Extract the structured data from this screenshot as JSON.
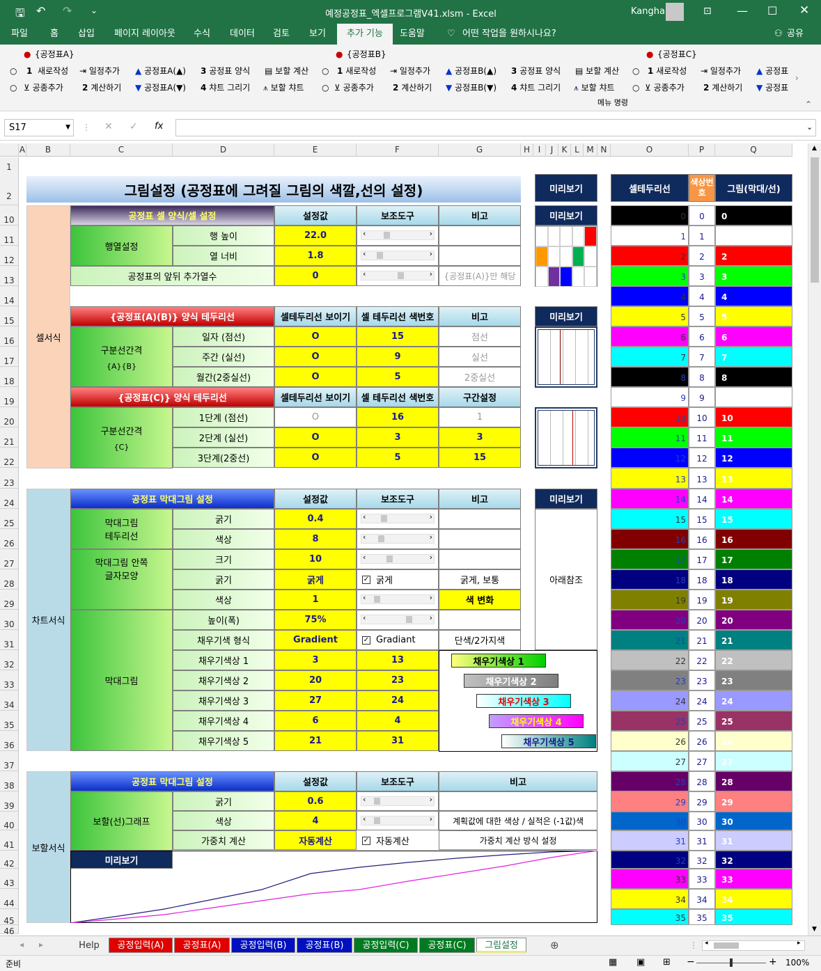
{
  "app": {
    "filename": "예정공정표_엑셀프로그램V41.xlsm",
    "app_name": "Excel",
    "user": "Kangha",
    "sep": "-"
  },
  "ribbon_tabs": [
    "파일",
    "홈",
    "삽입",
    "페이지 레이아웃",
    "수식",
    "데이터",
    "검토",
    "보기",
    "추가 기능",
    "도움말"
  ],
  "tell_me": "어떤 작업을 원하시나요?",
  "share": "공유",
  "ribbon": {
    "groups": [
      {
        "title": "{공정표A}",
        "r1": [
          "새로작성",
          "일정추가",
          "공정표A(▲)",
          "공정표 양식",
          "보할 계산"
        ],
        "r2": [
          "공종추가",
          "계산하기",
          "공정표A(▼)",
          "챠트 그리기",
          "보할 챠트"
        ]
      },
      {
        "title": "{공정표B}",
        "r1": [
          "새로작성",
          "일정추가",
          "공정표B(▲)",
          "공정표 양식",
          "보할 계산"
        ],
        "r2": [
          "공종추가",
          "계산하기",
          "공정표B(▼)",
          "챠트 그리기",
          "보할 챠트"
        ]
      },
      {
        "title": "{공정표C}",
        "r1": [
          "새로작성",
          "일정추가",
          "공정표"
        ],
        "r2": [
          "공종추가",
          "계산하기",
          "공정표"
        ]
      }
    ],
    "nums": {
      "one": "1",
      "two": "2",
      "three": "3",
      "four": "4"
    },
    "menu_label": "메뉴 명령"
  },
  "namebox": "S17",
  "fx": "fx",
  "columns": [
    "A",
    "B",
    "C",
    "D",
    "E",
    "F",
    "G",
    "H",
    "I",
    "J",
    "K",
    "L",
    "M",
    "N",
    "O",
    "P",
    "Q"
  ],
  "rows": [
    "1",
    "2",
    "10",
    "11",
    "12",
    "13",
    "14",
    "15",
    "16",
    "17",
    "18",
    "19",
    "20",
    "21",
    "22",
    "23",
    "24",
    "25",
    "26",
    "27",
    "28",
    "29",
    "30",
    "31",
    "32",
    "33",
    "34",
    "35",
    "36",
    "37",
    "38",
    "39",
    "40",
    "41",
    "42",
    "43",
    "44",
    "45",
    "46"
  ],
  "title": "그림설정 (공정표에 그려질 그림의 색깔,선의 설정)",
  "preview": "미리보기",
  "side": {
    "cell": "셀서식",
    "chart": "차트서식",
    "bohal": "보할서식"
  },
  "sec1": {
    "h": [
      "공정표 셀 양식/셀 설정",
      "설정값",
      "보조도구",
      "비고"
    ],
    "group": "행열설정",
    "r1": "행 높이",
    "v1": "22.0",
    "r2": "열 너비",
    "v2": "1.8",
    "r3": "공정표의 앞뒤 추가열수",
    "v3": "0",
    "n3": "{공정표(A)}만 해당"
  },
  "sec2": {
    "h": [
      "{공정표(A)(B)} 양식 테두리선",
      "셀테두리선 보이기",
      "셀 테두리선 색번호",
      "비고"
    ],
    "group": "구분선간격",
    "sub": "{A}{B}",
    "rows": [
      [
        "일자 (점선)",
        "O",
        "15",
        "점선"
      ],
      [
        "주간 (실선)",
        "O",
        "9",
        "실선"
      ],
      [
        "월간(2중실선)",
        "O",
        "5",
        "2중실선"
      ]
    ]
  },
  "sec3": {
    "h": [
      "{공정표(C)} 양식 테두리선",
      "셀테두리선 보이기",
      "셀 테두리선 색번호",
      "구간설정"
    ],
    "group": "구분선간격",
    "sub": "{C}",
    "rows": [
      [
        "1단계 (점선)",
        "O",
        "16",
        "1"
      ],
      [
        "2단계 (실선)",
        "O",
        "3",
        "3"
      ],
      [
        "3단계(2중선)",
        "O",
        "5",
        "15"
      ]
    ]
  },
  "sec4": {
    "h": [
      "공정표 막대그림 설정",
      "설정값",
      "보조도구",
      "비고"
    ],
    "g1": "막대그림",
    "g1b": "테두리선",
    "g2": "막대그림 안쪽",
    "g2b": "글자모양",
    "g3": "막대그림",
    "rows": [
      [
        "굵기",
        "0.4"
      ],
      [
        "색상",
        "8"
      ],
      [
        "크기",
        "10"
      ],
      [
        "굵기",
        "굵게"
      ],
      [
        "색상",
        "1"
      ],
      [
        "높이(폭)",
        "75%"
      ],
      [
        "채우기색 형식",
        "Gradient"
      ],
      [
        "채우기색상 1",
        "3"
      ],
      [
        "채우기색상 2",
        "20"
      ],
      [
        "채우기색상 3",
        "27"
      ],
      [
        "채우기색상 4",
        "6"
      ],
      [
        "채우기색상 5",
        "21"
      ]
    ],
    "fvals": [
      "13",
      "23",
      "24",
      "4",
      "31"
    ],
    "chk_bold": "굵게",
    "note_bold": "굵게, 보통",
    "color_change": "색 변화",
    "chk_grad": "Gradiant",
    "note_grad": "단색/2가지색",
    "below": "아래참조",
    "fills": [
      "채우기색상 1",
      "채우기색상 2",
      "채우기색상 3",
      "채우기색상 4",
      "채우기색상 5"
    ]
  },
  "sec5": {
    "h": [
      "공정표 막대그림 설정",
      "설정값",
      "보조도구",
      "비고"
    ],
    "group": "보할(선)그래프",
    "rows": [
      [
        "굵기",
        "0.6",
        ""
      ],
      [
        "색상",
        "4",
        "계획값에 대한 색상 / 실적은 (-1값)색"
      ],
      [
        "가중치 계산",
        "자동계산",
        "가중치 계산 방식 설정"
      ]
    ],
    "chk": "자동계산"
  },
  "palette_h": [
    "셀테두리선",
    "색상번호",
    "그림(막대/선)"
  ],
  "palette": [
    "#000000",
    "#ffffff",
    "#ff0000",
    "#00ff00",
    "#0000ff",
    "#ffff00",
    "#ff00ff",
    "#00ffff",
    "#000000",
    "#ffffff",
    "#ff0000",
    "#00ff00",
    "#0000ff",
    "#ffff00",
    "#ff00ff",
    "#00ffff",
    "#800000",
    "#008000",
    "#000080",
    "#808000",
    "#800080",
    "#008080",
    "#c0c0c0",
    "#808080",
    "#9999ff",
    "#993366",
    "#ffffcc",
    "#ccffff",
    "#660066",
    "#ff8080",
    "#0066cc",
    "#ccccff",
    "#000080",
    "#ff00ff",
    "#ffff00",
    "#00ffff"
  ],
  "palette_nums": [
    "0",
    "1",
    "2",
    "3",
    "4",
    "5",
    "6",
    "7",
    "8",
    "9",
    "10",
    "11",
    "12",
    "13",
    "14",
    "15",
    "16",
    "17",
    "18",
    "19",
    "20",
    "21",
    "22",
    "23",
    "24",
    "25",
    "26",
    "27",
    "28",
    "29",
    "30",
    "31",
    "32",
    "33",
    "34",
    "35"
  ],
  "sheet_tabs": [
    "Help",
    "공정입력(A)",
    "공정표(A)",
    "공정입력(B)",
    "공정표(B)",
    "공정입력(C)",
    "공정표(C)",
    "그림설정"
  ],
  "status": {
    "ready": "준비",
    "zoom": "100%"
  }
}
